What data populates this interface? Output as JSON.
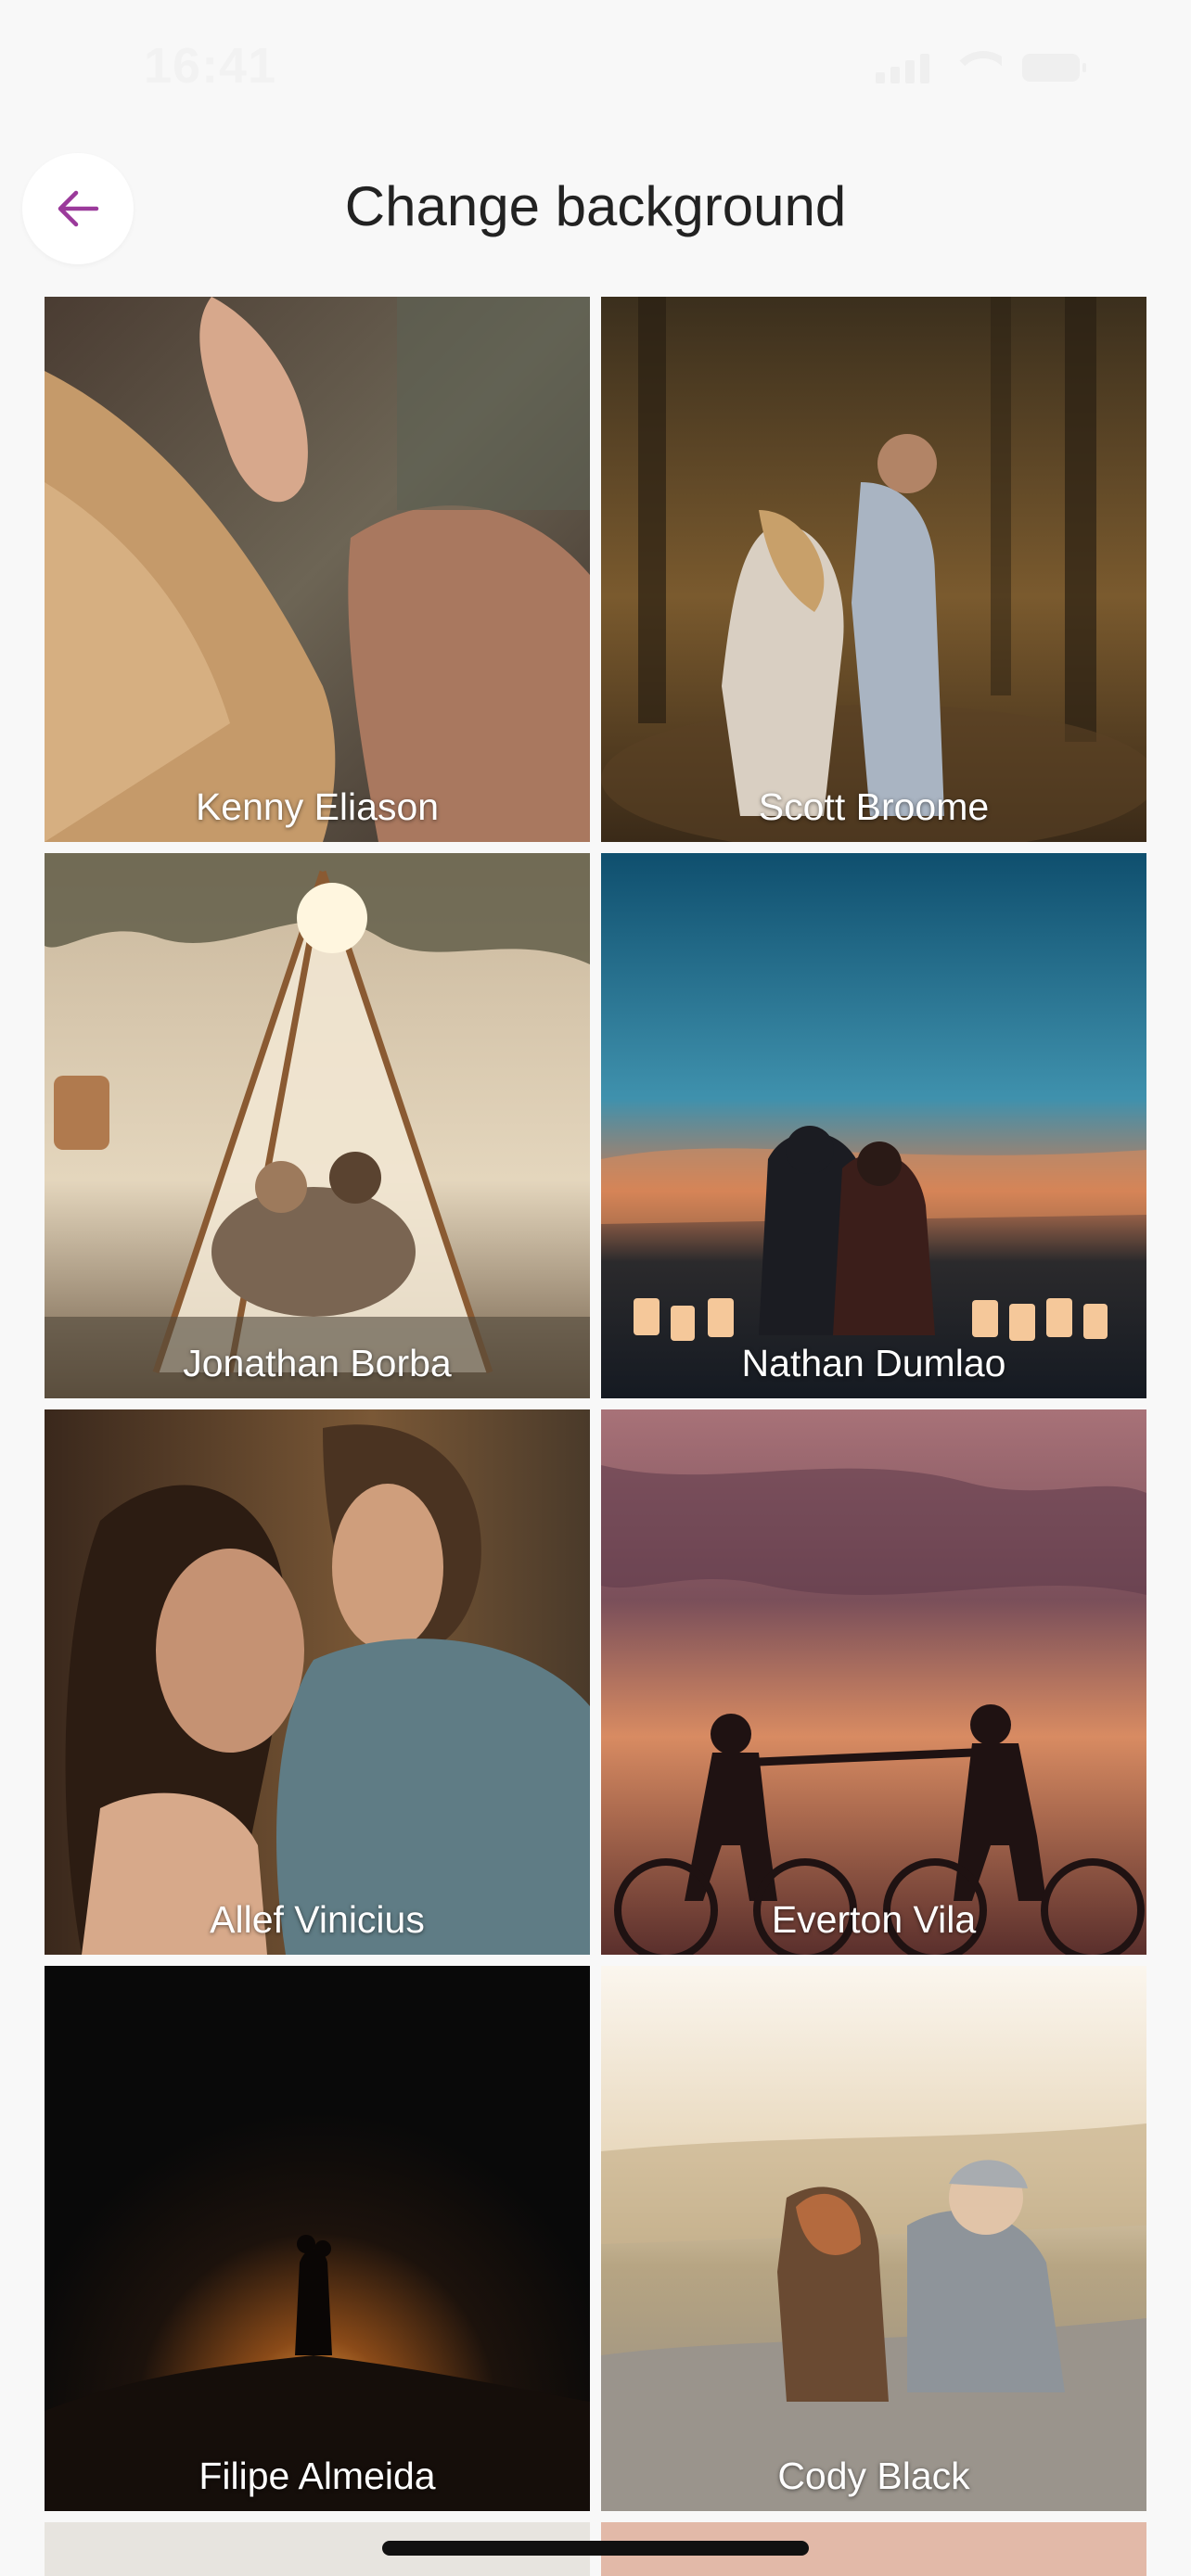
{
  "status_bar": {
    "time": "16:41"
  },
  "header": {
    "title": "Change background",
    "back_icon": "arrow-left-icon",
    "accent": "#9b3a9b"
  },
  "backgrounds": [
    {
      "credit": "Kenny Eliason"
    },
    {
      "credit": "Scott Broome"
    },
    {
      "credit": "Jonathan Borba"
    },
    {
      "credit": "Nathan Dumlao"
    },
    {
      "credit": "Allef Vinicius"
    },
    {
      "credit": "Everton Vila"
    },
    {
      "credit": "Filipe Almeida"
    },
    {
      "credit": "Cody Black"
    }
  ]
}
